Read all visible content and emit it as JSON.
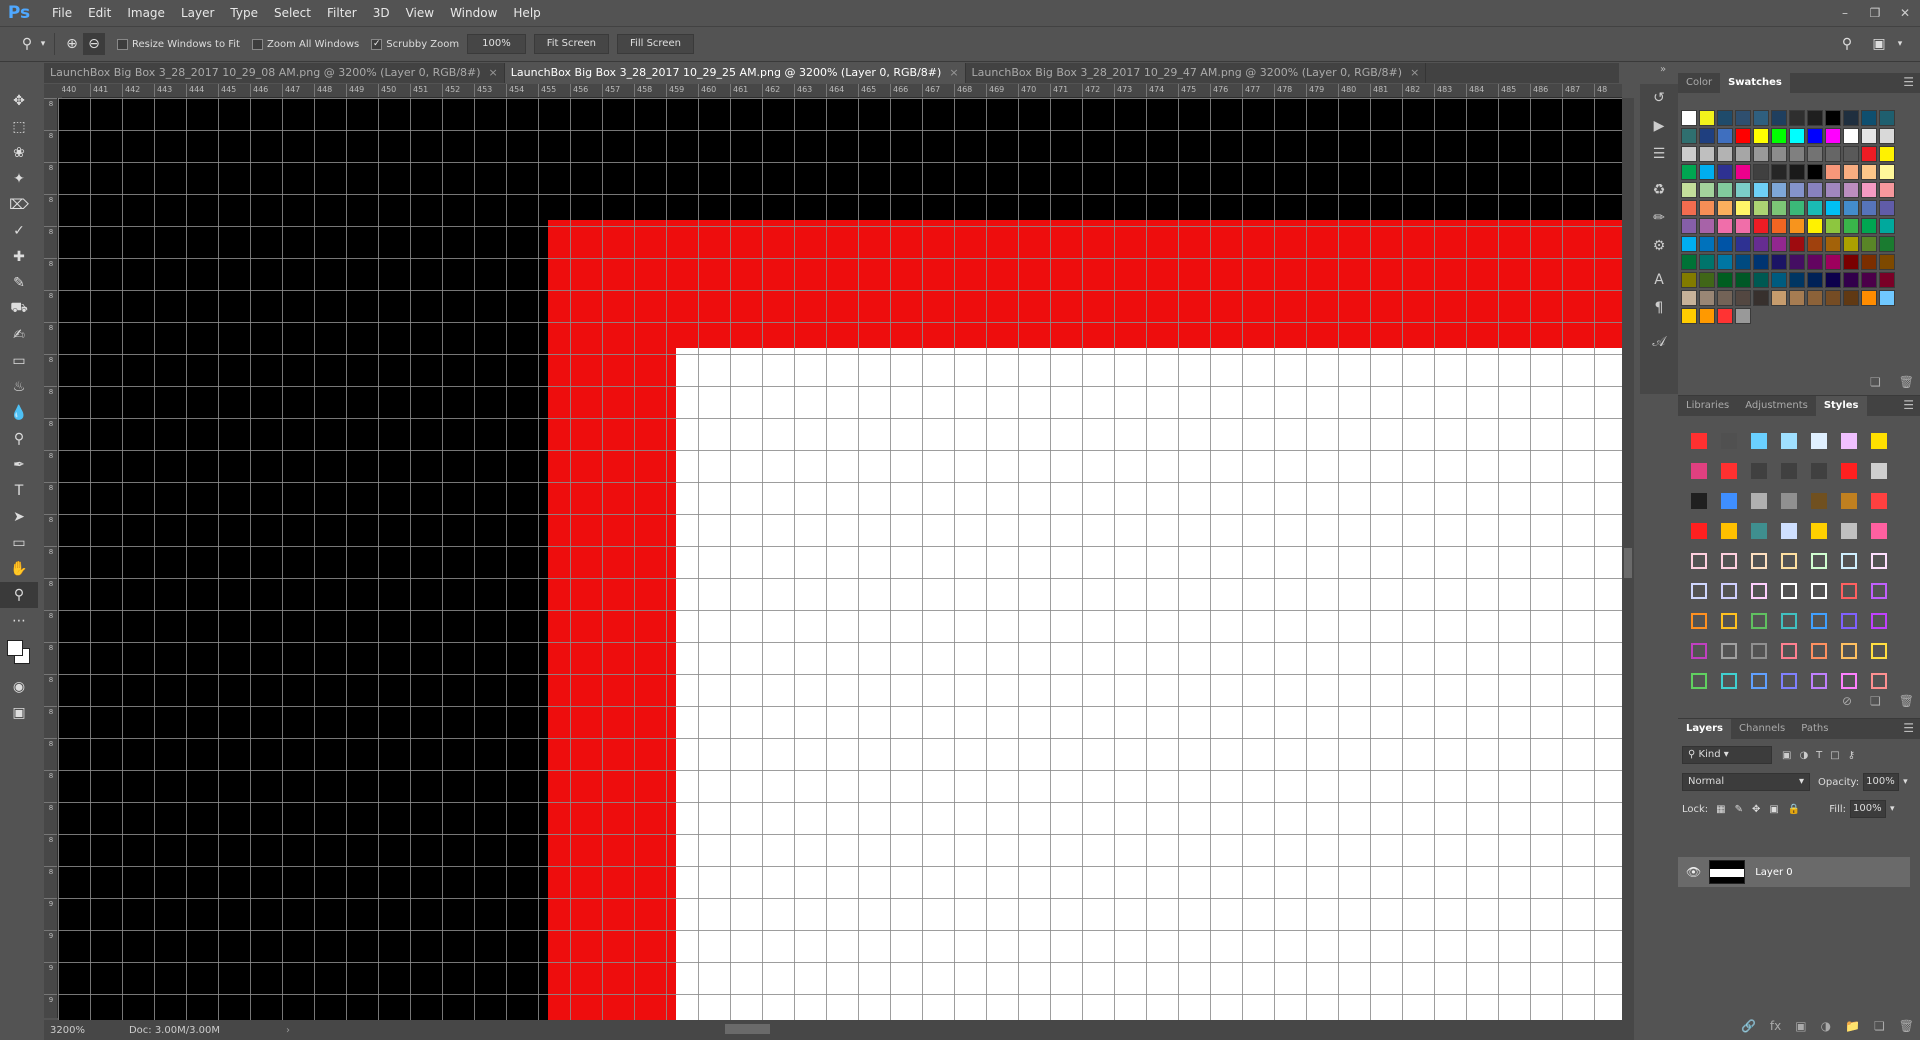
{
  "app": {
    "logo": "Ps"
  },
  "menu": [
    "File",
    "Edit",
    "Image",
    "Layer",
    "Type",
    "Select",
    "Filter",
    "3D",
    "View",
    "Window",
    "Help"
  ],
  "window_controls": [
    "–",
    "❐",
    "✕"
  ],
  "options": {
    "resize_windows": "Resize Windows to Fit",
    "zoom_all": "Zoom All Windows",
    "scrubby": "Scrubby Zoom",
    "zoom_value": "100%",
    "fit_screen": "Fit Screen",
    "fill_screen": "Fill Screen"
  },
  "tabs": [
    {
      "label": "LaunchBox Big Box 3_28_2017 10_29_08 AM.png @ 3200% (Layer 0, RGB/8#)",
      "active": false
    },
    {
      "label": "LaunchBox Big Box 3_28_2017 10_29_25 AM.png @ 3200% (Layer 0, RGB/8#)",
      "active": true
    },
    {
      "label": "LaunchBox Big Box 3_28_2017 10_29_47 AM.png @ 3200% (Layer 0, RGB/8#)",
      "active": false
    }
  ],
  "ruler_top_labels": [
    "440",
    "441",
    "442",
    "443",
    "444",
    "445",
    "446",
    "447",
    "448",
    "449",
    "450",
    "451",
    "452",
    "453",
    "454",
    "455",
    "456",
    "457",
    "458",
    "459",
    "460",
    "461",
    "462",
    "463",
    "464",
    "465",
    "466",
    "467",
    "468",
    "469",
    "470",
    "471",
    "472",
    "473",
    "474",
    "475",
    "476",
    "477",
    "478",
    "479",
    "480",
    "481",
    "482",
    "483",
    "484",
    "485",
    "486",
    "487",
    "48"
  ],
  "ruler_left_labels": [
    "8",
    "8",
    "8",
    "8",
    "8",
    "8",
    "8",
    "8",
    "8",
    "8",
    "8",
    "8",
    "8",
    "8",
    "8",
    "8",
    "8",
    "8",
    "8",
    "8",
    "8",
    "8",
    "8",
    "8",
    "8",
    "9",
    "9",
    "9",
    "9",
    "9"
  ],
  "canvas_colors": {
    "black": "#000000",
    "red": "#ee0d0d",
    "white": "#ffffff"
  },
  "status": {
    "zoom": "3200%",
    "doc": "Doc: 3.00M/3.00M"
  },
  "color_panel": {
    "tabs": [
      "Color",
      "Swatches"
    ],
    "active": "Swatches"
  },
  "swatches": [
    "#ffffff",
    "#f2f21c",
    "#1f4b6b",
    "#2f4f6f",
    "#2f5f7f",
    "#1f3f5f",
    "#2f2f2f",
    "#1f1f1f",
    "#000000",
    "#1f2f3f",
    "#0f4f6f",
    "#1f5f6f",
    "#2f6f6f",
    "#1f3f7f",
    "#3f6fbf",
    "#ff0000",
    "#ffff00",
    "#00ff00",
    "#00ffff",
    "#0000ff",
    "#ff00ff",
    "#ffffff",
    "#e6e6e6",
    "#d9d9d9",
    "#cccccc",
    "#bfbfbf",
    "#b3b3b3",
    "#a6a6a6",
    "#999999",
    "#8c8c8c",
    "#808080",
    "#737373",
    "#666666",
    "#595959",
    "#ed1c24",
    "#fff200",
    "#00a651",
    "#00aeef",
    "#2e3192",
    "#ec008c",
    "#404040",
    "#262626",
    "#1a1a1a",
    "#000000",
    "#f7977a",
    "#f9ad81",
    "#fdc68a",
    "#fff79a",
    "#c4df9b",
    "#a3d39c",
    "#82ca9d",
    "#7bcdc8",
    "#6ecff6",
    "#7ea7d8",
    "#8493ca",
    "#8882be",
    "#a187be",
    "#bc8dbf",
    "#f49ac2",
    "#f6989d",
    "#f26c4f",
    "#f68e56",
    "#fbaf5d",
    "#fff568",
    "#acd373",
    "#7cc576",
    "#3bb878",
    "#1abbb4",
    "#00bff3",
    "#438ccb",
    "#5674b9",
    "#605ca8",
    "#855fa8",
    "#a763a8",
    "#f06eaa",
    "#f06ea9",
    "#ed1c24",
    "#f26522",
    "#f7941d",
    "#fff200",
    "#8dc63f",
    "#39b54a",
    "#00a651",
    "#00a99d",
    "#00aeef",
    "#0072bc",
    "#0054a6",
    "#2e3192",
    "#662d91",
    "#92278f",
    "#9e0b0f",
    "#a0410d",
    "#a36209",
    "#aba000",
    "#598527",
    "#1a7b30",
    "#007236",
    "#00746b",
    "#0076a3",
    "#004a80",
    "#003471",
    "#1b1464",
    "#440e62",
    "#630460",
    "#9e005d",
    "#790000",
    "#7b2e00",
    "#7d4900",
    "#827b00",
    "#406618",
    "#005e20",
    "#005826",
    "#005952",
    "#005b7f",
    "#003663",
    "#002157",
    "#0d004c",
    "#32004b",
    "#4b0049",
    "#7a0026",
    "#c7b299",
    "#998675",
    "#736357",
    "#534741",
    "#37302d",
    "#c69c6d",
    "#a67c52",
    "#8c6239",
    "#754c24",
    "#603913",
    "#ff8c00",
    "#70c8ff",
    "#ffcc00",
    "#ff9900",
    "#ff3333",
    "#999999"
  ],
  "styles_panel": {
    "tabs": [
      "Libraries",
      "Adjustments",
      "Styles"
    ],
    "active": "Styles"
  },
  "styles": [
    "#ff3030",
    "#505050",
    "#6ad0ff",
    "#9fe0ff",
    "#e0f0ff",
    "#f0c0ff",
    "#ffe000",
    "#e04080",
    "#ff3030",
    "#404040",
    "#404040",
    "#404040",
    "#ff2020",
    "#cfcfcf",
    "#202020",
    "#3f8fff",
    "#b0b0b0",
    "#909090",
    "#705020",
    "#c08020",
    "#ff4040",
    "#ff2020",
    "#ffc000",
    "#3f8f8f",
    "#cfe0ff",
    "#ffd000",
    "#c0c0c0",
    "#ff60a0",
    "#ffd0e0",
    "#ffd0e0",
    "#ffe0c0",
    "#ffe0a0",
    "#d0ffd0",
    "#d0f0ff",
    "#ffe0ff",
    "#d0d8ff",
    "#d0d0ff",
    "#ffd0ff",
    "#ffffff",
    "#ffffff",
    "#ff6060",
    "#c060ff",
    "#ff9020",
    "#ffc020",
    "#60c060",
    "#40c0c0",
    "#40a0ff",
    "#8060ff",
    "#c040ff",
    "#c040c0",
    "#a0a0a0",
    "#909090",
    "#ff8090",
    "#ff9060",
    "#ffc060",
    "#ffe040",
    "#60d060",
    "#40d0d0",
    "#60a0ff",
    "#8080ff",
    "#c080ff",
    "#ff80ff",
    "#ff9090"
  ],
  "layers_panel": {
    "tabs": [
      "Layers",
      "Channels",
      "Paths"
    ],
    "active": "Layers",
    "kind": "Kind",
    "blend": "Normal",
    "opacity_label": "Opacity:",
    "opacity": "100%",
    "lock_label": "Lock:",
    "fill_label": "Fill:",
    "fill": "100%",
    "layer_name": "Layer 0"
  }
}
